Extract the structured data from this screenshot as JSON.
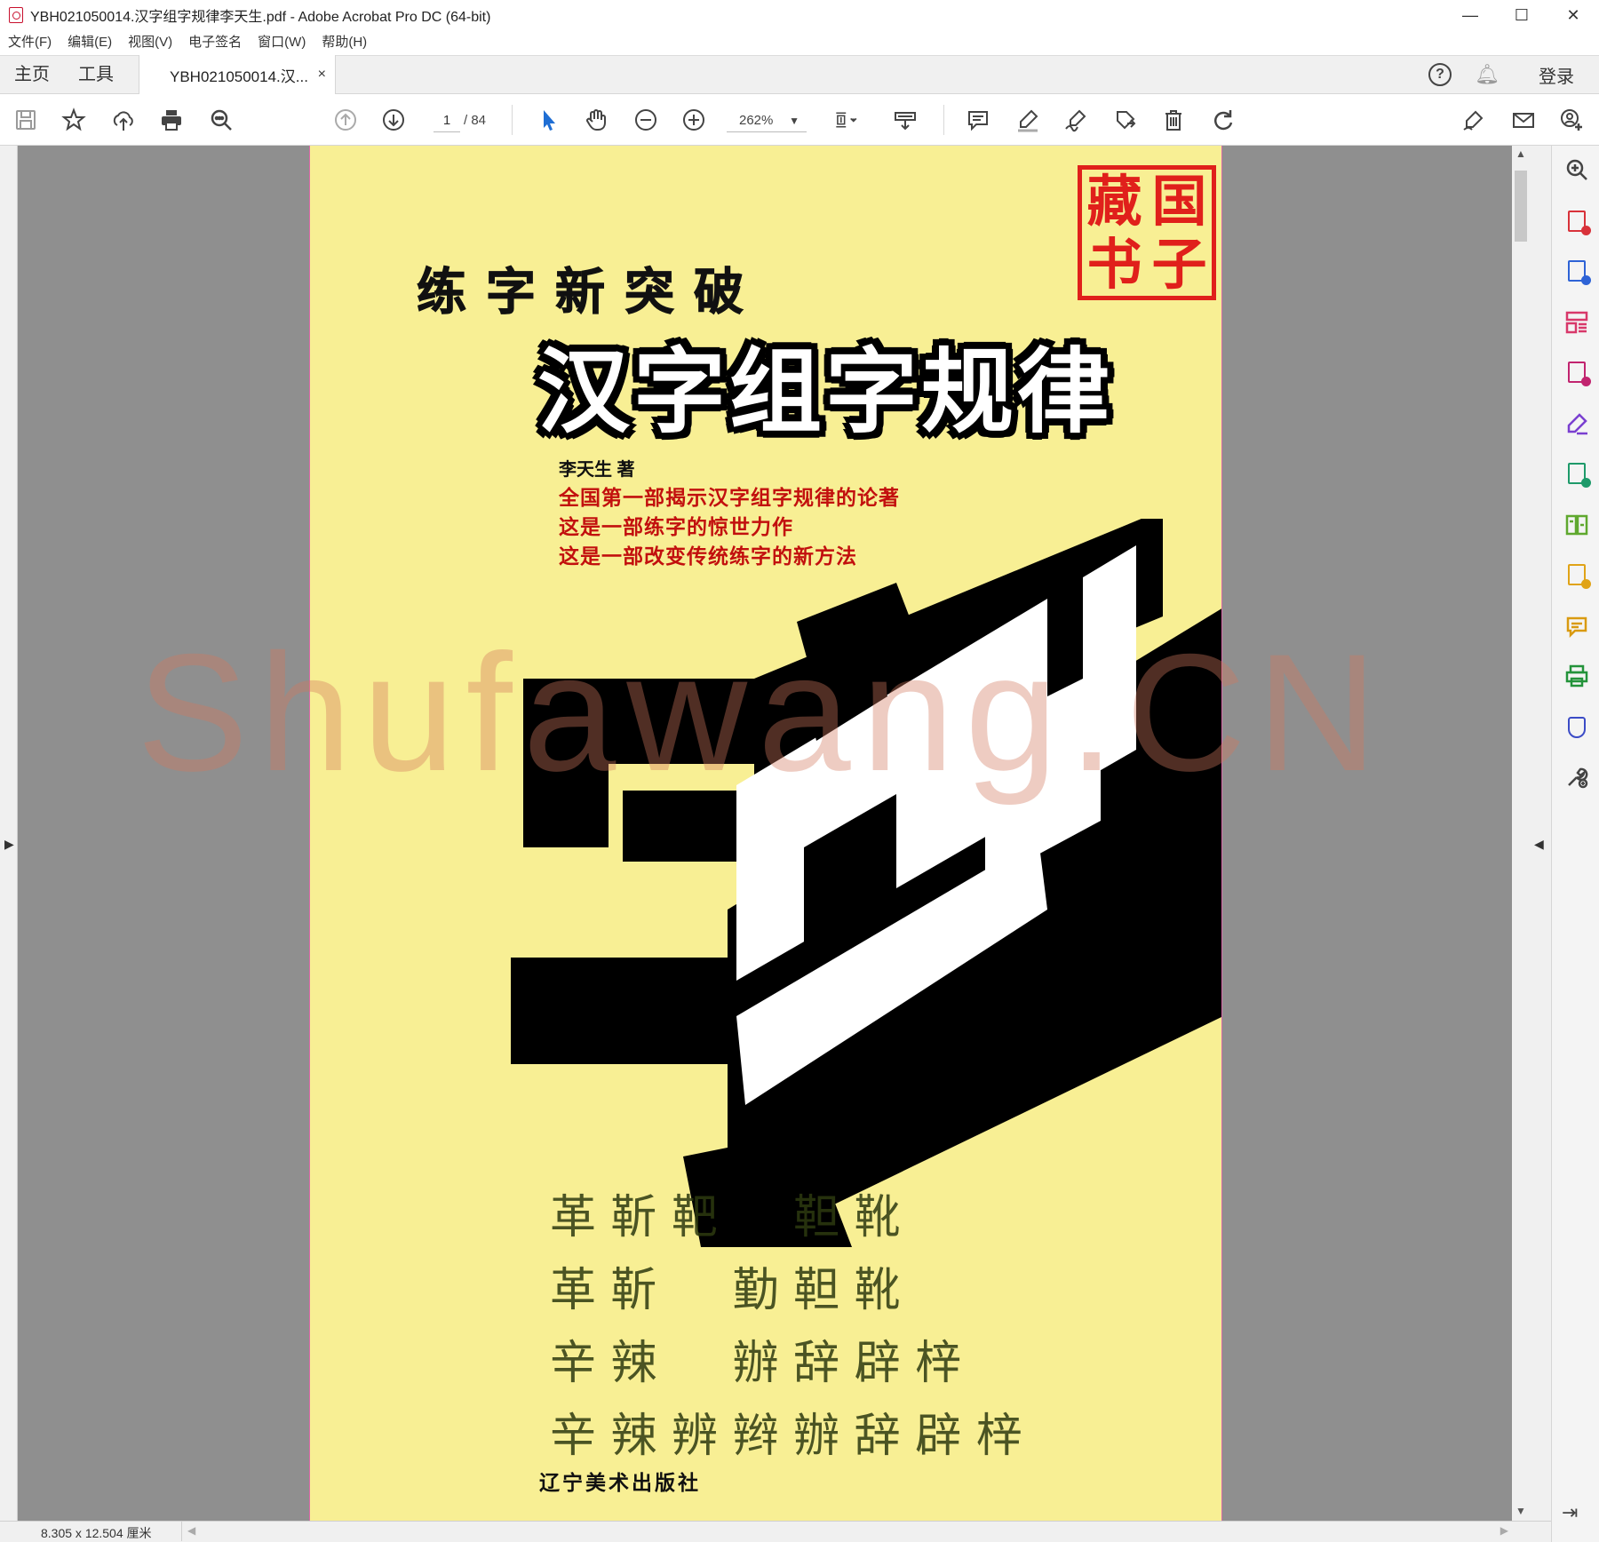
{
  "window": {
    "title": "YBH021050014.汉字组字规律李天生.pdf - Adobe Acrobat Pro DC (64-bit)",
    "minimize": "—",
    "maximize": "☐",
    "close": "✕"
  },
  "menu": [
    "文件(F)",
    "编辑(E)",
    "视图(V)",
    "电子签名",
    "窗口(W)",
    "帮助(H)"
  ],
  "tabs": {
    "home": "主页",
    "tools": "工具",
    "document": "YBH021050014.汉...",
    "document_close": "×",
    "help": "?",
    "login": "登录"
  },
  "toolbar": {
    "page_current": "1",
    "page_total": "/ 84",
    "zoom": "262%"
  },
  "cover": {
    "seal": [
      "藏",
      "国",
      "书",
      "子"
    ],
    "series_title": "练字新突破",
    "main_title": "汉字组字规律",
    "author": "李天生 著",
    "slogans": [
      "全国第一部揭示汉字组字规律的论著",
      "这是一部练字的惊世力作",
      "这是一部改变传统练字的新方法"
    ],
    "publisher": "辽宁美术出版社",
    "calligraphy_rows": [
      "革 靳 靶 　 靼 靴",
      "革 靳 　 勤 靼 靴",
      "辛 辣 　 辦 辞 辟 梓",
      "辛 辣 辨 辫 辦 辞 辟 梓"
    ],
    "watermark": "Shufawang.CN"
  },
  "status": {
    "dimensions": "8.305 x 12.504 厘米"
  },
  "colors": {
    "cover_bg": "#f8ef94",
    "seal_red": "#e0201b",
    "slogan_red": "#c2100e",
    "viewer_bg": "#8f8f8f"
  }
}
